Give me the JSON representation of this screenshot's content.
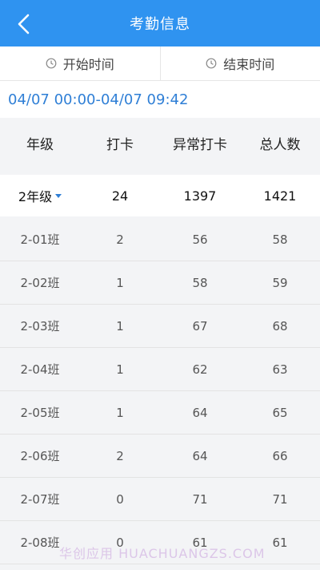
{
  "header": {
    "title": "考勤信息",
    "back_icon": "chevron-left-icon",
    "color": "#2f93f0"
  },
  "time_bar": {
    "start_label": "开始时间",
    "end_label": "结束时间",
    "icon": "clock-icon"
  },
  "range_text": "04/07 00:00-04/07 09:42",
  "table": {
    "columns": [
      "年级",
      "打卡",
      "异常打卡",
      "总人数"
    ],
    "summary": {
      "grade": "2年级",
      "checkin": "24",
      "abnormal": "1397",
      "total": "1421"
    },
    "rows": [
      {
        "class": "2-01班",
        "checkin": "2",
        "abnormal": "56",
        "total": "58"
      },
      {
        "class": "2-02班",
        "checkin": "1",
        "abnormal": "58",
        "total": "59"
      },
      {
        "class": "2-03班",
        "checkin": "1",
        "abnormal": "67",
        "total": "68"
      },
      {
        "class": "2-04班",
        "checkin": "1",
        "abnormal": "62",
        "total": "63"
      },
      {
        "class": "2-05班",
        "checkin": "1",
        "abnormal": "64",
        "total": "65"
      },
      {
        "class": "2-06班",
        "checkin": "2",
        "abnormal": "64",
        "total": "66"
      },
      {
        "class": "2-07班",
        "checkin": "0",
        "abnormal": "71",
        "total": "71"
      },
      {
        "class": "2-08班",
        "checkin": "0",
        "abnormal": "61",
        "total": "61"
      }
    ]
  },
  "watermark": "华创应用 HUACHUANGZS.COM",
  "accent_color": "#2f7fd6"
}
